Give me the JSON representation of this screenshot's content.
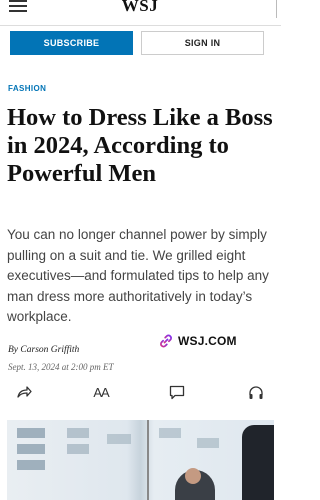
{
  "header": {
    "logo": "WSJ"
  },
  "buttons": {
    "subscribe": "SUBSCRIBE",
    "sign_in": "SIGN IN"
  },
  "article": {
    "section": "FASHION",
    "headline": "How to Dress Like a Boss in 2024, According to Powerful Men",
    "dek": "You can no longer channel power by simply pulling on a suit and tie. We grilled eight executives—and formulated tips to help any man dress more authoritatively in today’s workplace.",
    "byline_prefix": "By",
    "author": "Carson Griffith",
    "date": "Sept. 13, 2024 at 2:00 pm ET"
  },
  "link_badge": {
    "text": "WSJ.COM",
    "icon": "link-icon"
  },
  "actions": {
    "share_icon": "share-icon",
    "text_size_label": "AA",
    "comment_icon": "comment-icon",
    "audio_icon": "headphones-icon"
  },
  "colors": {
    "accent": "#0274b6",
    "link_icon_gradient": [
      "#d63384",
      "#7b2ff7"
    ]
  }
}
